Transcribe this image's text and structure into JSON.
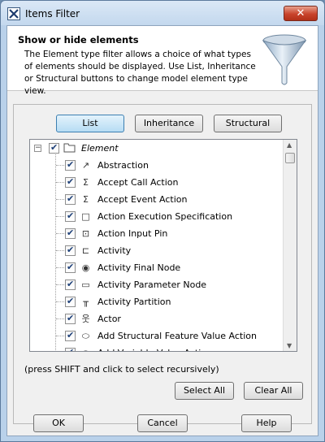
{
  "window": {
    "title": "Items Filter",
    "close_label": "✕"
  },
  "header": {
    "title": "Show or hide elements",
    "description": "The Element type filter allows a choice of what types of elements should be displayed. Use List, Inheritance or Structural buttons to change model element type view."
  },
  "view_buttons": {
    "list": "List",
    "inheritance": "Inheritance",
    "structural": "Structural",
    "active": "list"
  },
  "tree": {
    "root": {
      "label": "Element",
      "expander": "−",
      "checked": true
    },
    "items": [
      {
        "label": "Abstraction",
        "icon": "abstraction-icon",
        "glyph": "↗",
        "checked": true
      },
      {
        "label": "Accept Call Action",
        "icon": "accept-call-action-icon",
        "glyph": "Σ",
        "checked": true
      },
      {
        "label": "Accept Event Action",
        "icon": "accept-event-action-icon",
        "glyph": "Σ",
        "checked": true
      },
      {
        "label": "Action Execution Specification",
        "icon": "action-execution-specification-icon",
        "glyph": "□",
        "checked": true
      },
      {
        "label": "Action Input Pin",
        "icon": "action-input-pin-icon",
        "glyph": "⊡",
        "checked": true
      },
      {
        "label": "Activity",
        "icon": "activity-icon",
        "glyph": "⊏",
        "checked": true
      },
      {
        "label": "Activity Final Node",
        "icon": "activity-final-node-icon",
        "glyph": "◉",
        "checked": true
      },
      {
        "label": "Activity Parameter Node",
        "icon": "activity-parameter-node-icon",
        "glyph": "▭",
        "checked": true
      },
      {
        "label": "Activity Partition",
        "icon": "activity-partition-icon",
        "glyph": "╥",
        "checked": true
      },
      {
        "label": "Actor",
        "icon": "actor-icon",
        "glyph": "웃",
        "checked": true
      },
      {
        "label": "Add Structural Feature Value Action",
        "icon": "add-structural-feature-value-action-icon",
        "glyph": "⬭",
        "checked": true
      },
      {
        "label": "Add Variable Value Action",
        "icon": "add-variable-value-action-icon",
        "glyph": "⬭",
        "checked": true
      }
    ]
  },
  "hint": "(press SHIFT and click to select recursively)",
  "selection_buttons": {
    "select_all": "Select All",
    "clear_all": "Clear All"
  },
  "footer": {
    "ok": "OK",
    "cancel": "Cancel",
    "help": "Help"
  }
}
